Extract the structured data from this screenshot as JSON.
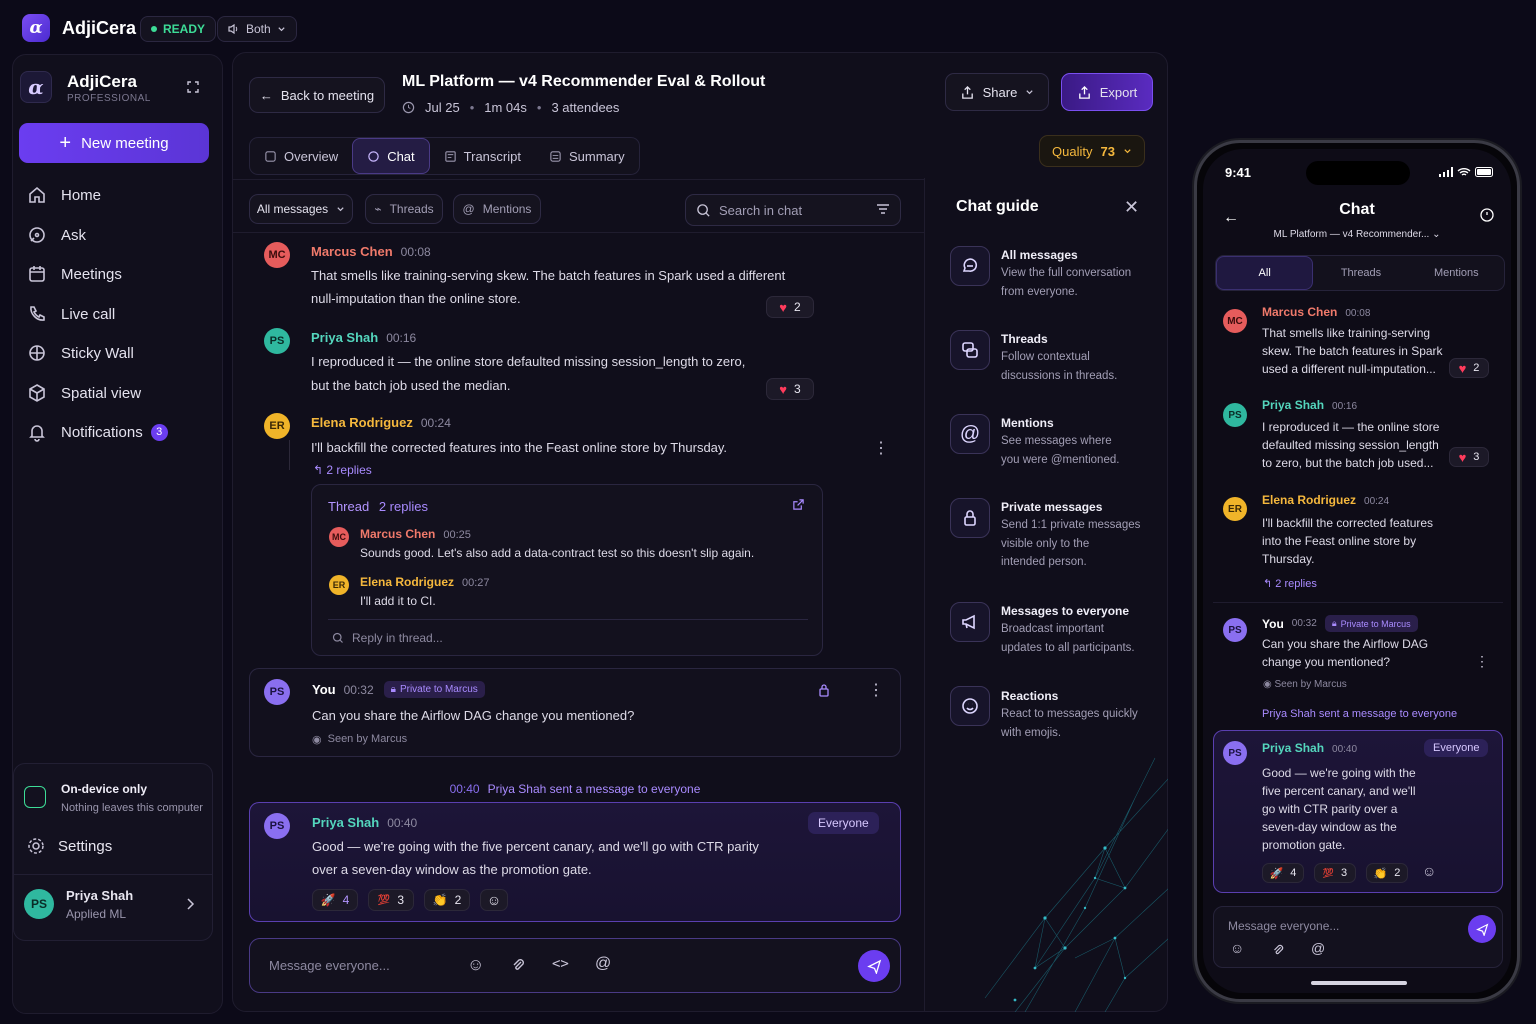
{
  "app": {
    "name": "AdjiCera",
    "status": "READY",
    "mode": "Both"
  },
  "sidebar": {
    "brand": "AdjiCera",
    "plan": "PROFESSIONAL",
    "new_meeting": "New meeting",
    "items": [
      {
        "label": "Home",
        "icon": "home-icon"
      },
      {
        "label": "Ask",
        "icon": "chat-icon"
      },
      {
        "label": "Meetings",
        "icon": "calendar-icon"
      },
      {
        "label": "Live call",
        "icon": "phone-icon"
      },
      {
        "label": "Sticky Wall",
        "icon": "sticky-icon"
      },
      {
        "label": "Spatial view",
        "icon": "spatial-icon"
      },
      {
        "label": "Notifications",
        "icon": "bell-icon",
        "badge": "3"
      }
    ],
    "ondevice_title": "On-device only",
    "ondevice_sub": "Nothing leaves this computer",
    "settings": "Settings",
    "user_name": "Priya Shah",
    "user_role": "Applied ML",
    "user_initials": "PS"
  },
  "header": {
    "back": "Back to meeting",
    "title": "ML Platform — v4 Recommender Eval & Rollout",
    "date": "Jul 25",
    "duration": "1m 04s",
    "attendees": "3 attendees",
    "share": "Share",
    "export": "Export",
    "quality_label": "Quality",
    "quality_value": "73"
  },
  "tabs": [
    "Overview",
    "Chat",
    "Transcript",
    "Summary"
  ],
  "filters": {
    "all": "All messages",
    "threads": "Threads",
    "mentions": "Mentions",
    "search_placeholder": "Search in chat"
  },
  "messages": [
    {
      "initials": "MC",
      "name": "Marcus Chen",
      "time": "00:08",
      "line1": "That smells like training-serving skew. The batch features in Spark used a different",
      "line2": "null-imputation than the online store.",
      "reaction": "2"
    },
    {
      "initials": "PS",
      "name": "Priya Shah",
      "time": "00:16",
      "line1": "I reproduced it — the online store defaulted missing session_length to zero,",
      "line2": "but the batch job used the median.",
      "reaction": "3"
    },
    {
      "initials": "ER",
      "name": "Elena Rodriguez",
      "time": "00:24",
      "line1": "I'll backfill the corrected features into the Feast online store by Thursday.",
      "replies": "2 replies"
    }
  ],
  "thread": {
    "title": "Thread",
    "count": "2 replies",
    "r1_initials": "MC",
    "r1_name": "Marcus Chen",
    "r1_time": "00:25",
    "r1_text": "Sounds good. Let's also add a data-contract test so this doesn't slip again.",
    "r2_initials": "ER",
    "r2_name": "Elena Rodriguez",
    "r2_time": "00:27",
    "r2_text": "I'll add it to CI.",
    "reply_placeholder": "Reply in thread..."
  },
  "private_msg": {
    "initials": "PS",
    "name": "You",
    "time": "00:32",
    "tag": "Private to Marcus",
    "text": "Can you share the Airflow DAG change you mentioned?",
    "seen": "Seen by Marcus"
  },
  "divider": {
    "time": "00:40",
    "text": "Priya Shah sent a message to everyone"
  },
  "everyone_msg": {
    "initials": "PS",
    "name": "Priya Shah",
    "time": "00:40",
    "tag": "Everyone",
    "line1": "Good — we're going with the five percent canary, and we'll go with CTR parity",
    "line2": "over a seven-day window as the promotion gate.",
    "r1": "4",
    "r2": "3",
    "r3": "2"
  },
  "composer": {
    "placeholder": "Message everyone..."
  },
  "guide": {
    "title": "Chat guide",
    "items": [
      {
        "title": "All messages",
        "desc1": "View the full conversation",
        "desc2": "from everyone.",
        "icon": "chat-bubble-icon"
      },
      {
        "title": "Threads",
        "desc1": "Follow contextual",
        "desc2": "discussions in threads.",
        "icon": "threads-icon"
      },
      {
        "title": "Mentions",
        "desc1": "See messages where",
        "desc2": "you were @mentioned.",
        "icon": "at-icon"
      },
      {
        "title": "Private messages",
        "desc1": "Send 1:1 private messages",
        "desc2": "visible only to the",
        "desc3": "intended person.",
        "icon": "lock-icon"
      },
      {
        "title": "Messages to everyone",
        "desc1": "Broadcast important",
        "desc2": "updates to all participants.",
        "icon": "megaphone-icon"
      },
      {
        "title": "Reactions",
        "desc1": "React to messages quickly",
        "desc2": "with emojis.",
        "icon": "smile-icon"
      }
    ]
  },
  "phone": {
    "time": "9:41",
    "title": "Chat",
    "subtitle": "ML Platform — v4 Recommender...",
    "tabs": [
      "All",
      "Threads",
      "Mentions"
    ],
    "m1": {
      "name": "Marcus Chen",
      "time": "00:08",
      "l1": "That smells like training-serving",
      "l2": "skew. The batch features in Spark",
      "l3": "used a different null-imputation...",
      "reaction": "2"
    },
    "m2": {
      "name": "Priya Shah",
      "time": "00:16",
      "l1": "I reproduced it — the online store",
      "l2": "defaulted missing session_length",
      "l3": "to zero, but the batch job used...",
      "reaction": "3"
    },
    "m3": {
      "name": "Elena Rodriguez",
      "time": "00:24",
      "l1": "I'll backfill the corrected features",
      "l2": "into the Feast online store by",
      "l3": "Thursday.",
      "replies": "2 replies"
    },
    "m4": {
      "name": "You",
      "time": "00:32",
      "tag": "Private to Marcus",
      "l1": "Can you share the Airflow DAG",
      "l2": "change you mentioned?",
      "seen": "Seen by Marcus"
    },
    "divider": "Priya Shah sent a message to everyone",
    "m5": {
      "name": "Priya Shah",
      "time": "00:40",
      "tag": "Everyone",
      "l1": "Good — we're going with the",
      "l2": "five percent canary, and we'll",
      "l3": "go with CTR parity over a",
      "l4": "seven-day window as the",
      "l5": "promotion gate.",
      "r1": "4",
      "r2": "3",
      "r3": "2"
    },
    "composer": "Message everyone..."
  },
  "colors": {
    "accent": "#6b3df0",
    "background": "#0c0a18",
    "ready": "#3ddc97"
  }
}
